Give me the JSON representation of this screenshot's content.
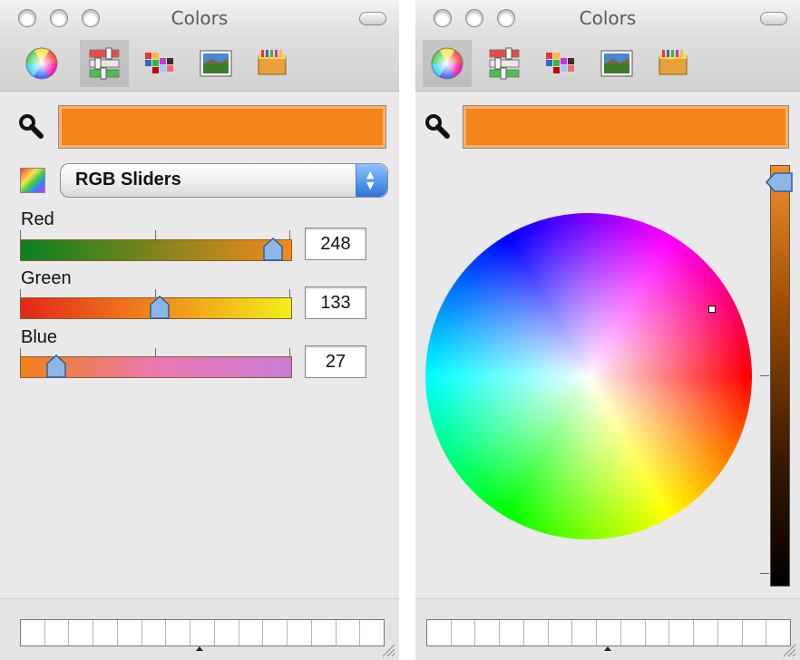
{
  "left_panel": {
    "title": "Colors",
    "selected_mode": "RGB Sliders",
    "current_color": "#f5851b",
    "sliders": [
      {
        "label": "Red",
        "value": "248",
        "fraction": 0.97
      },
      {
        "label": "Green",
        "value": "133",
        "fraction": 0.52
      },
      {
        "label": "Blue",
        "value": "27",
        "fraction": 0.11
      }
    ],
    "toolbar_icons": [
      "color-wheel-icon",
      "sliders-icon",
      "palettes-icon",
      "image-palettes-icon",
      "crayons-icon"
    ]
  },
  "right_panel": {
    "title": "Colors",
    "current_color": "#f5851b",
    "brightness_fraction": 0.97,
    "toolbar_icons": [
      "color-wheel-icon",
      "sliders-icon",
      "palettes-icon",
      "image-palettes-icon",
      "crayons-icon"
    ]
  },
  "colors": {
    "window_bg": "#e9e9e9",
    "accent_blue": "#2b74d9",
    "swatch_orange": "#f5851b"
  }
}
